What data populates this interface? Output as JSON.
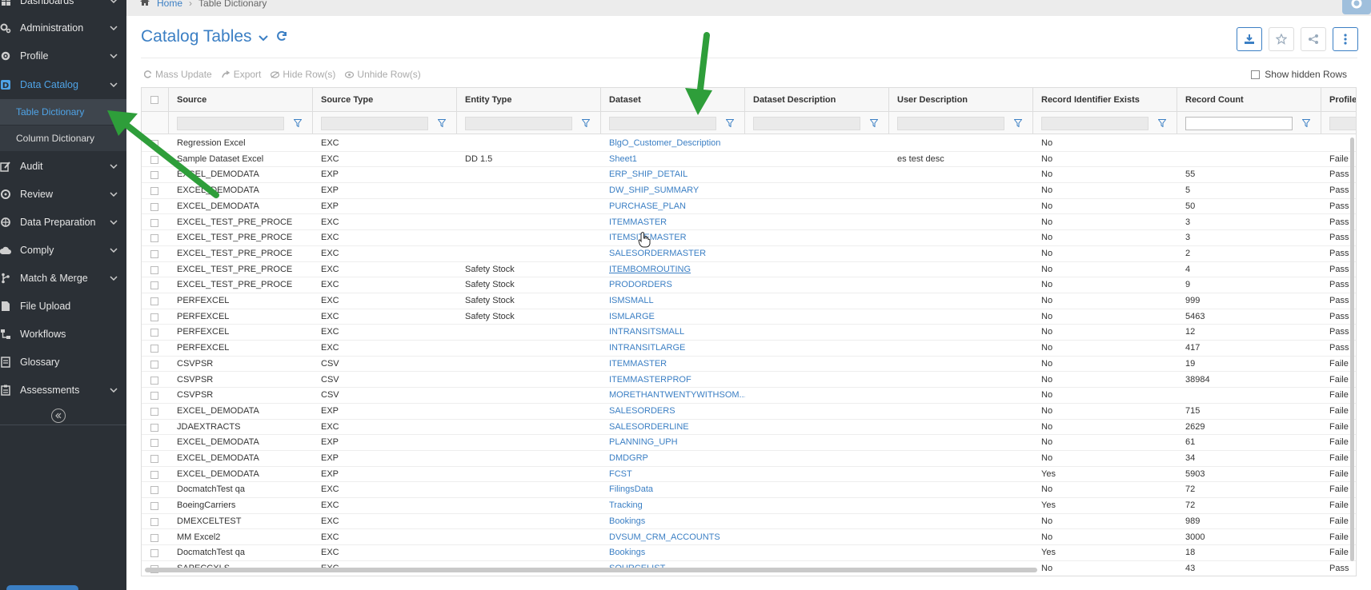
{
  "sidebar": {
    "items": [
      {
        "label": "Dashboards",
        "icon": "dashboard-icon"
      },
      {
        "label": "Administration",
        "icon": "cogs-icon"
      },
      {
        "label": "Profile",
        "icon": "gear-icon"
      },
      {
        "label": "Data Catalog",
        "icon": "catalog-icon"
      },
      {
        "label": "Audit",
        "icon": "edit-icon"
      },
      {
        "label": "Review",
        "icon": "review-icon"
      },
      {
        "label": "Data Preparation",
        "icon": "prep-icon"
      },
      {
        "label": "Comply",
        "icon": "cloud-icon"
      },
      {
        "label": "Match & Merge",
        "icon": "merge-icon"
      },
      {
        "label": "File Upload",
        "icon": "file-icon"
      },
      {
        "label": "Workflows",
        "icon": "workflow-icon"
      },
      {
        "label": "Glossary",
        "icon": "glossary-icon"
      },
      {
        "label": "Assessments",
        "icon": "assessment-icon"
      }
    ],
    "sub_items": [
      "Table Dictionary",
      "Column Dictionary"
    ]
  },
  "breadcrumb": {
    "home": "Home",
    "current": "Table Dictionary"
  },
  "page": {
    "title": "Catalog Tables"
  },
  "toolbar": {
    "mass_update": "Mass Update",
    "export": "Export",
    "hide_rows": "Hide Row(s)",
    "unhide_rows": "Unhide Row(s)",
    "show_hidden": "Show hidden Rows"
  },
  "grid": {
    "columns": [
      "Source",
      "Source Type",
      "Entity Type",
      "Dataset",
      "Dataset Description",
      "User Description",
      "Record Identifier Exists",
      "Record Count",
      "Profile"
    ],
    "rows": [
      [
        "Regression Excel",
        "EXC",
        "",
        "BlgO_Customer_Description",
        "",
        "",
        "No",
        "",
        ""
      ],
      [
        "Sample Dataset Excel",
        "EXC",
        "DD 1.5",
        "Sheet1",
        "",
        "es test desc",
        "No",
        "",
        "Faile"
      ],
      [
        "EXCEL_DEMODATA",
        "EXP",
        "",
        "ERP_SHIP_DETAIL",
        "",
        "",
        "No",
        "55",
        "Pass"
      ],
      [
        "EXCEL_DEMODATA",
        "EXP",
        "",
        "DW_SHIP_SUMMARY",
        "",
        "",
        "No",
        "5",
        "Pass"
      ],
      [
        "EXCEL_DEMODATA",
        "EXP",
        "",
        "PURCHASE_PLAN",
        "",
        "",
        "No",
        "50",
        "Pass"
      ],
      [
        "EXCEL_TEST_PRE_PROCE",
        "EXC",
        "",
        "ITEMMASTER",
        "",
        "",
        "No",
        "3",
        "Pass"
      ],
      [
        "EXCEL_TEST_PRE_PROCE",
        "EXC",
        "",
        "ITEMSITEMASTER",
        "",
        "",
        "No",
        "3",
        "Pass"
      ],
      [
        "EXCEL_TEST_PRE_PROCE",
        "EXC",
        "",
        "SALESORDERMASTER",
        "",
        "",
        "No",
        "2",
        "Pass"
      ],
      [
        "EXCEL_TEST_PRE_PROCE",
        "EXC",
        "Safety Stock",
        "ITEMBOMROUTING",
        "",
        "",
        "No",
        "4",
        "Pass"
      ],
      [
        "EXCEL_TEST_PRE_PROCE",
        "EXC",
        "Safety Stock",
        "PRODORDERS",
        "",
        "",
        "No",
        "9",
        "Pass"
      ],
      [
        "PERFEXCEL",
        "EXC",
        "Safety Stock",
        "ISMSMALL",
        "",
        "",
        "No",
        "999",
        "Pass"
      ],
      [
        "PERFEXCEL",
        "EXC",
        "Safety Stock",
        "ISMLARGE",
        "",
        "",
        "No",
        "5463",
        "Pass"
      ],
      [
        "PERFEXCEL",
        "EXC",
        "",
        "INTRANSITSMALL",
        "",
        "",
        "No",
        "12",
        "Pass"
      ],
      [
        "PERFEXCEL",
        "EXC",
        "",
        "INTRANSITLARGE",
        "",
        "",
        "No",
        "417",
        "Pass"
      ],
      [
        "CSVPSR",
        "CSV",
        "",
        "ITEMMASTER",
        "",
        "",
        "No",
        "19",
        "Faile"
      ],
      [
        "CSVPSR",
        "CSV",
        "",
        "ITEMMASTERPROF",
        "",
        "",
        "No",
        "38984",
        "Faile"
      ],
      [
        "CSVPSR",
        "CSV",
        "",
        "MORETHANTWENTYWITHSOM...",
        "",
        "",
        "No",
        "",
        "Faile"
      ],
      [
        "EXCEL_DEMODATA",
        "EXP",
        "",
        "SALESORDERS",
        "",
        "",
        "No",
        "715",
        "Faile"
      ],
      [
        "JDAEXTRACTS",
        "EXC",
        "",
        "SALESORDERLINE",
        "",
        "",
        "No",
        "2629",
        "Faile"
      ],
      [
        "EXCEL_DEMODATA",
        "EXP",
        "",
        "PLANNING_UPH",
        "",
        "",
        "No",
        "61",
        "Faile"
      ],
      [
        "EXCEL_DEMODATA",
        "EXP",
        "",
        "DMDGRP",
        "",
        "",
        "No",
        "34",
        "Faile"
      ],
      [
        "EXCEL_DEMODATA",
        "EXP",
        "",
        "FCST",
        "",
        "",
        "Yes",
        "5903",
        "Faile"
      ],
      [
        "DocmatchTest qa",
        "EXC",
        "",
        "FilingsData",
        "",
        "",
        "No",
        "72",
        "Faile"
      ],
      [
        "BoeingCarriers",
        "EXC",
        "",
        "Tracking",
        "",
        "",
        "Yes",
        "72",
        "Faile"
      ],
      [
        "DMEXCELTEST",
        "EXC",
        "",
        "Bookings",
        "",
        "",
        "No",
        "989",
        "Faile"
      ],
      [
        "MM Excel2",
        "EXC",
        "",
        "DVSUM_CRM_ACCOUNTS",
        "",
        "",
        "No",
        "3000",
        "Faile"
      ],
      [
        "DocmatchTest qa",
        "EXC",
        "",
        "Bookings",
        "",
        "",
        "Yes",
        "18",
        "Faile"
      ],
      [
        "SAPECCXLS",
        "EXC",
        "",
        "SOURCELIST",
        "",
        "",
        "No",
        "43",
        "Pass"
      ]
    ]
  },
  "colors": {
    "sidebar_bg": "#2b3036",
    "accent": "#3b7fc4",
    "arrow": "#2e9e3a"
  }
}
